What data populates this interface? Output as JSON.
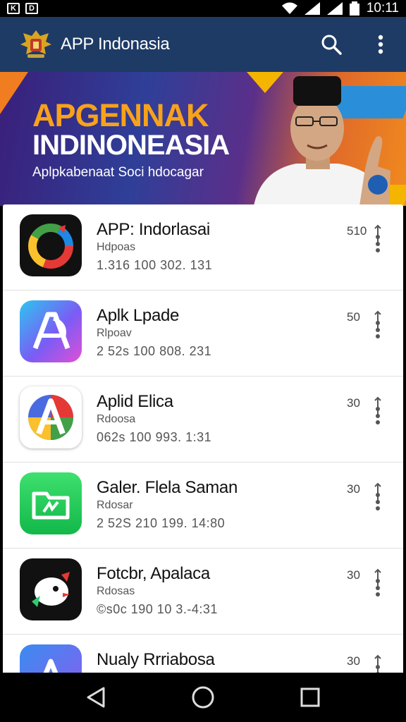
{
  "status": {
    "left_icons": [
      "K",
      "D"
    ],
    "time": "10:11"
  },
  "app_bar": {
    "title": "APP Indonasia",
    "search_icon": "search-icon",
    "menu_icon": "more-vert-icon"
  },
  "banner": {
    "heading1": "APGENNAK",
    "heading2": "INDINONEASIA",
    "subtitle": "Aplpkabenaat Soci hdocagar"
  },
  "apps": [
    {
      "name": "APP: Indorlasai",
      "sub": "Hdpoas",
      "meta": "1.316 100 302. 131",
      "count": "510",
      "icon": "google-style-icon"
    },
    {
      "name": "Aplk Lpade",
      "sub": "Rlpoav",
      "meta": "2 52s 100 808. 231",
      "count": "50",
      "icon": "a-gradient-icon"
    },
    {
      "name": "Aplid Elica",
      "sub": "Rdoosa",
      "meta": "062s 100 993. 1:31",
      "count": "30",
      "icon": "a-colorful-icon"
    },
    {
      "name": "Galer. Flela Saman",
      "sub": "Rdosar",
      "meta": "2 52S 210 199. 14:80",
      "count": "30",
      "icon": "green-folder-icon"
    },
    {
      "name": "Fotcbr, Apalaca",
      "sub": "Rdosas",
      "meta": "©s0c 190 10 3.-4:31",
      "count": "30",
      "icon": "bird-icon"
    },
    {
      "name": "Nualy Rrriabosa",
      "sub": "",
      "meta": "",
      "count": "30",
      "icon": "a-blue-icon"
    }
  ],
  "colors": {
    "app_bar": "#1e3b66",
    "banner_orange": "#f8a21a"
  }
}
